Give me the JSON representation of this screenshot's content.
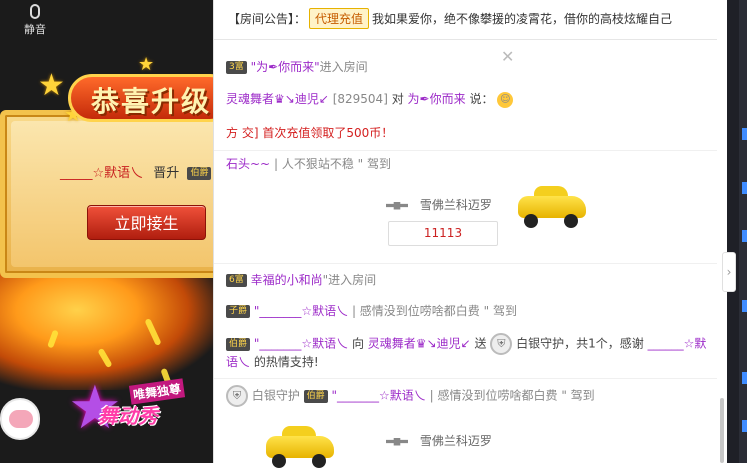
{
  "video": {
    "mute_label": "静音",
    "logo_main": "舞动秀",
    "logo_sub": "唯舞独尊"
  },
  "popup": {
    "title": "恭喜升级",
    "user": "_____☆默语乀",
    "action": "晋升",
    "rank_badge": "伯爵",
    "accept_label": "立即接生"
  },
  "chat": {
    "notice_label": "【房间公告】：",
    "notice_button": "代理充值",
    "notice_text": "我如果爱你，绝不像攀援的凌霄花，借你的高枝炫耀自己",
    "rows": {
      "r1_badge": "3富",
      "r1_user": "\"为✒你而来\"",
      "r1_text": "进入房间",
      "r2_user": "灵魂舞者♛↘迪児↙",
      "r2_id": "[829504]",
      "r2_mid": "对",
      "r2_target": "为✒你而来",
      "r2_say": "说：",
      "r3_tag": "方 交]",
      "r3_text": "首次充值领取了500币！",
      "r4_user": "石头~~",
      "r4_sep": "|",
      "r4_quote": "人不狠站不稳",
      "r4_arrive": "\" 驾到",
      "car1_name": "雪佛兰科迈罗",
      "car1_count": "11113",
      "r5_badge": "6富",
      "r5_user": "幸福的小和尚",
      "r5_text": "\"进入房间",
      "r6_badge": "子爵",
      "r6_user": "\"_______☆默语乀",
      "r6_quote": "| 感情没到位唠啥都白费",
      "r6_arrive": "\" 驾到",
      "r7_badge": "伯爵",
      "r7_user": "\"_______☆默语乀",
      "r7_mid": "向",
      "r7_target": "灵魂舞者♛↘迪児↙",
      "r7_give": "送",
      "r7_gift": "白银守护，共1个，感谢",
      "r7_thank_user": "______☆默",
      "r7_line2_user": "语乀",
      "r7_line2_text": "的热情支持!",
      "r8_shield": "白银守护",
      "r8_badge": "伯爵",
      "r8_user": "\"_______☆默语乀",
      "r8_quote": "| 感情没到位唠啥都白费",
      "r8_arrive": "\" 驾到",
      "car2_name": "雪佛兰科迈罗"
    },
    "collapse_icon": "›"
  }
}
